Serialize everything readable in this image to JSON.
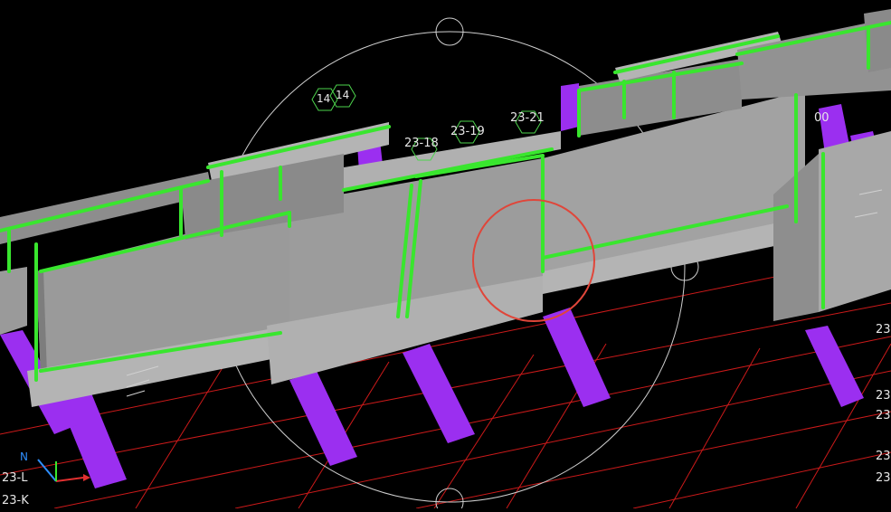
{
  "viewport": {
    "background": "#000000",
    "colors": {
      "panel": "#9a9a9a",
      "panel_dark": "#7d7d7d",
      "panel_light": "#b4b4b4",
      "rail_green": "#39e62e",
      "brace_purple": "#9b2ff0",
      "grid_red": "#cc1a1a",
      "grid_line": "#cfcfcf",
      "highlight_circle": "#e0463a"
    }
  },
  "grid_tags": {
    "t1": "14",
    "t2": "14",
    "t3": "23-18",
    "t4": "23-19",
    "t5": "23-21",
    "t6": "00",
    "t7": "23",
    "t8": "23",
    "t9": "23",
    "t10": "23",
    "t11": "23",
    "t12": "23-L",
    "t13": "23-K"
  },
  "axis_triad": {
    "icon": "ucs-axis-icon",
    "label": "N"
  },
  "highlight": {
    "icon": "selection-circle-icon"
  }
}
